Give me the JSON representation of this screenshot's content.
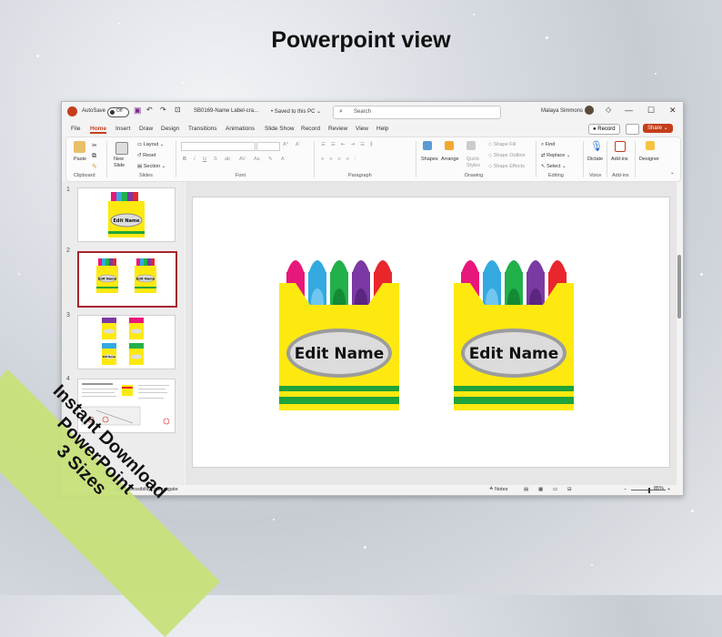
{
  "headline": "Powerpoint view",
  "titlebar": {
    "autosave_label": "AutoSave",
    "autosave_state": "Off",
    "document_name": "SB0169-Name Label-cra...",
    "save_status": "• Saved to this PC ⌄",
    "search_placeholder": "Search",
    "user_name": "Malaya Simmons"
  },
  "menu_tabs": [
    "File",
    "Home",
    "Insert",
    "Draw",
    "Design",
    "Transitions",
    "Animations",
    "Slide Show",
    "Record",
    "Review",
    "View",
    "Help"
  ],
  "menu_right": {
    "record_label": "Record",
    "share_label": "Share"
  },
  "ribbon": {
    "groups": [
      "Clipboard",
      "Slides",
      "Font",
      "Paragraph",
      "Drawing",
      "Editing",
      "Voice",
      "Add-ins"
    ],
    "paste": "Paste",
    "new_slide": "New Slide",
    "layout": "Layout",
    "reset": "Reset",
    "section": "Section",
    "shapes": "Shapes",
    "arrange": "Arrange",
    "quick_styles": "Quick Styles",
    "shape_fill": "Shape Fill",
    "shape_outline": "Shape Outline",
    "shape_effects": "Shape Effects",
    "find": "Find",
    "replace": "Replace",
    "select": "Select",
    "dictate": "Dictate",
    "add_ins": "Add-ins",
    "designer": "Designer"
  },
  "thumbnails": [
    {
      "num": "1",
      "label": "Edit Name"
    },
    {
      "num": "2",
      "label": "Edit Name"
    },
    {
      "num": "3",
      "label": "Edit Name"
    },
    {
      "num": "4",
      "label": ""
    }
  ],
  "slide": {
    "labels": [
      "Edit Name",
      "Edit Name"
    ]
  },
  "statusbar": {
    "accessibility": "Accessibility: Investigate",
    "notes": "Notes",
    "zoom": "85%"
  },
  "banner": [
    "Instant Download",
    "PowerPoint",
    "3 Sizes"
  ],
  "colors": {
    "accent": "#c43e1c",
    "banner": "#c8e07a",
    "box_yellow": "#fde910",
    "box_green": "#1fa33a",
    "crayons": [
      "#e8177b",
      "#33a9e0",
      "#22b04a",
      "#7b3aa3",
      "#e8262c"
    ]
  }
}
